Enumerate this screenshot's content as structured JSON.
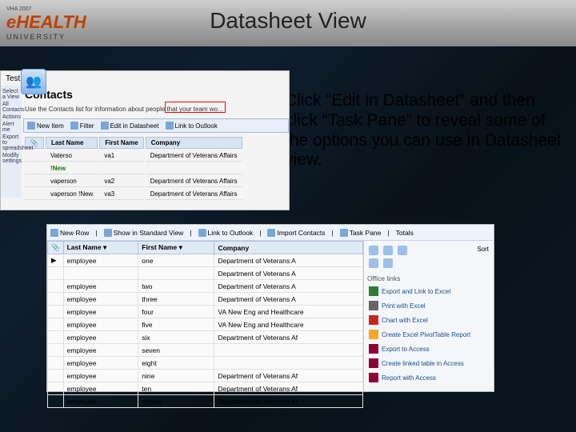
{
  "slide": {
    "title": "Datasheet View",
    "logo": {
      "main": "eHEALTH",
      "top": "VHA 2007",
      "sub": "UNIVERSITY"
    },
    "overlay_text": "Click “Edit in Datasheet” and then click “Task Pane” to reveal some of the options you can use in Datasheet view.",
    "page_number": "57"
  },
  "top_panel": {
    "breadcrumb": "Test Area",
    "list_title": "Contacts",
    "description": "Use the Contacts list for information about people that your team wo...",
    "toolbar": {
      "b1": "New Item",
      "b2": "Filter",
      "b3": "Edit in Datasheet",
      "b4": "Link to Outlook"
    },
    "sidebar": {
      "s1": "Select a View",
      "s2": "All Contacts",
      "s3": "Actions",
      "s4": "Alert me",
      "s5": "Export to spreadsheet",
      "s6": "Modify settings"
    },
    "cols": {
      "c1": "Last Name",
      "c2": "First Name",
      "c3": "Company"
    },
    "rows": [
      {
        "last": "Vaterso",
        "first": "va1",
        "company": "Department of Veterans Affairs"
      },
      {
        "last": "!New",
        "first": "",
        "company": "",
        "new": true
      },
      {
        "last": "vaperson",
        "first": "va2",
        "company": "Department of Veterans Affairs"
      },
      {
        "last": "vaperson !New",
        "first": "va3",
        "company": "Department of Veterans Affairs"
      }
    ]
  },
  "bottom_panel": {
    "toolbar": {
      "b1": "New Row",
      "b2": "Show in Standard View",
      "b3": "Link to Outlook",
      "b4": "Import Contacts",
      "b5": "Task Pane",
      "b6": "Totals"
    },
    "cols": {
      "c0": "",
      "c1": "Last Name",
      "c2": "First Name",
      "c3": "Company"
    },
    "rows": [
      {
        "last": "employee",
        "first": "one",
        "company": "Department of Veterans A"
      },
      {
        "last": "",
        "first": "",
        "company": "Department of Veterans A"
      },
      {
        "last": "employee",
        "first": "two",
        "company": "Department of Veterans A"
      },
      {
        "last": "employee",
        "first": "three",
        "company": "Department of Veterans A"
      },
      {
        "last": "employee",
        "first": "four",
        "company": "VA New Eng and Healthcare"
      },
      {
        "last": "employee",
        "first": "five",
        "company": "VA New Eng and Healthcare"
      },
      {
        "last": "employee",
        "first": "six",
        "company": "Department of Veterans Af"
      },
      {
        "last": "employee",
        "first": "seven",
        "company": ""
      },
      {
        "last": "employee",
        "first": "eight",
        "company": ""
      },
      {
        "last": "employee",
        "first": "nine",
        "company": "Department of Veterans Af"
      },
      {
        "last": "employee",
        "first": "ten",
        "company": "Department of Veterans Af"
      },
      {
        "last": "employee",
        "first": "eleven",
        "company": "Department of Veterans Af"
      }
    ],
    "task_pane": {
      "sort": "Sort",
      "section": "Office links",
      "links": {
        "l1": "Export and Link to Excel",
        "l2": "Print with Excel",
        "l3": "Chart with Excel",
        "l4": "Create Excel PivotTable Report",
        "l5": "Export to Access",
        "l6": "Create linked table in Access",
        "l7": "Report with Access"
      }
    }
  },
  "chart_data": {
    "type": "table",
    "note": "screenshot contains UI grids, no chart"
  }
}
